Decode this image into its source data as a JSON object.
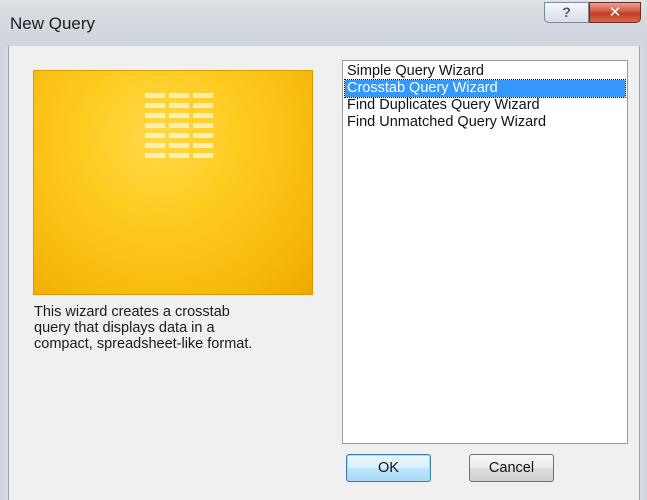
{
  "window": {
    "title": "New Query",
    "help_icon": "?",
    "close_icon": "✕"
  },
  "preview": {
    "description": "This wizard creates a crosstab\nquery that displays data in a\ncompact, spreadsheet-like format.",
    "colors": {
      "background": "#ffcc22",
      "grid": "#fff3c8"
    }
  },
  "query_list": {
    "items": [
      {
        "label": "Simple Query Wizard",
        "selected": false
      },
      {
        "label": "Crosstab Query Wizard",
        "selected": true
      },
      {
        "label": "Find Duplicates Query Wizard",
        "selected": false
      },
      {
        "label": "Find Unmatched Query Wizard",
        "selected": false
      }
    ],
    "selection_color": "#3399ff"
  },
  "buttons": {
    "ok": "OK",
    "cancel": "Cancel"
  }
}
